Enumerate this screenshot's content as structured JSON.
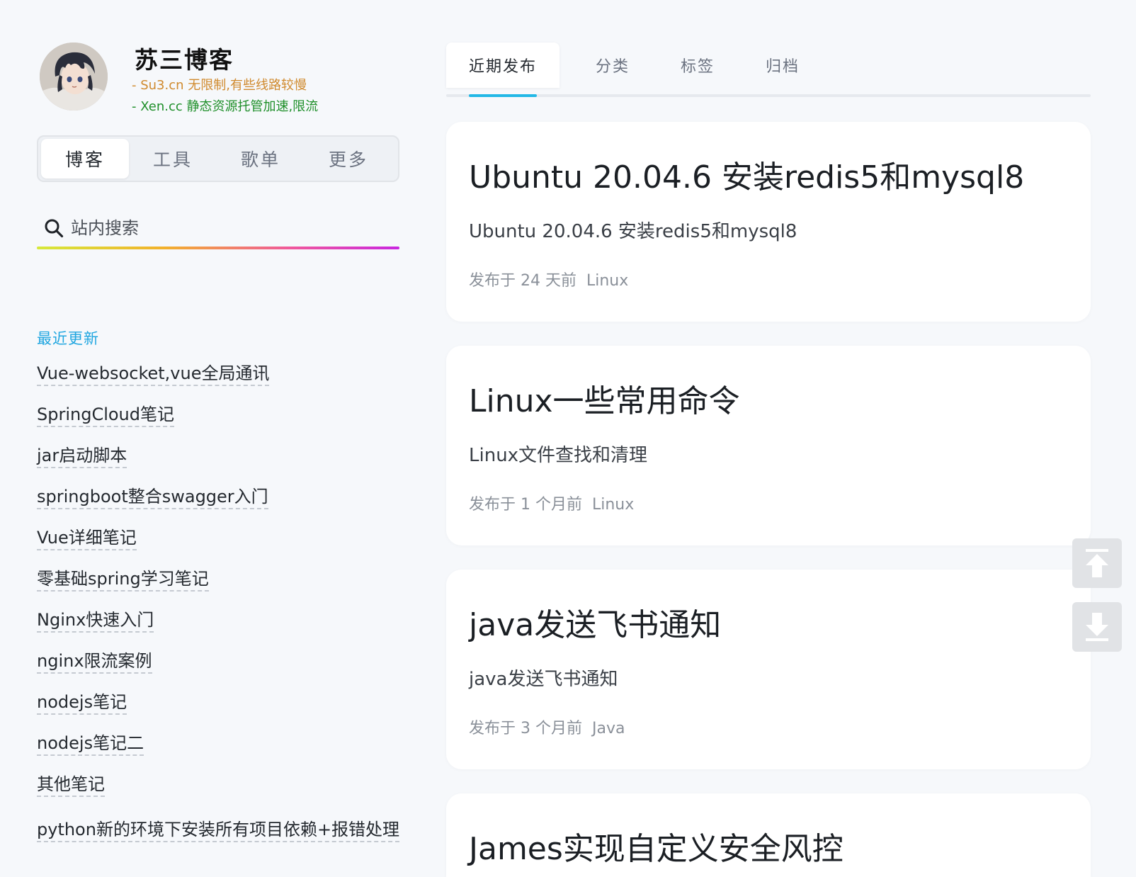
{
  "profile": {
    "title": "苏三博客",
    "mirrors": [
      "- Su3.cn 无限制,有些线路较慢",
      "- Xen.cc 静态资源托管加速,限流"
    ]
  },
  "nav_tabs": [
    "博客",
    "工具",
    "歌单",
    "更多"
  ],
  "search": {
    "placeholder": "站内搜索"
  },
  "recent": {
    "title": "最近更新",
    "items": [
      "Vue-websocket,vue全局通讯",
      "SpringCloud笔记",
      "jar启动脚本",
      "springboot整合swagger入门",
      "Vue详细笔记",
      "零基础spring学习笔记",
      "Nginx快速入门",
      "nginx限流案例",
      "nodejs笔记",
      "nodejs笔记二",
      "其他笔记",
      "python新的环境下安装所有项目依赖+报错处理"
    ]
  },
  "content_tabs": [
    "近期发布",
    "分类",
    "标签",
    "归档"
  ],
  "posts": [
    {
      "title": "Ubuntu 20.04.6 安装redis5和mysql8",
      "summary": "Ubuntu 20.04.6 安装redis5和mysql8",
      "published": "发布于 24 天前",
      "category": "Linux"
    },
    {
      "title": "Linux一些常用命令",
      "summary": "Linux文件查找和清理",
      "published": "发布于 1 个月前",
      "category": "Linux"
    },
    {
      "title": "java发送飞书通知",
      "summary": "java发送飞书通知",
      "published": "发布于 3 个月前",
      "category": "Java"
    },
    {
      "title": "James实现自定义安全风控",
      "summary": "",
      "published": "",
      "category": ""
    }
  ],
  "colors": {
    "accent": "#22b8e6",
    "recent_title": "#20a6e0",
    "mirror_1": "#d08a2e",
    "mirror_2": "#1f8f2a"
  },
  "icons": {
    "scroll_top": "arrow-up-to-top-icon",
    "scroll_bottom": "arrow-down-to-bottom-icon",
    "search": "search-icon"
  }
}
